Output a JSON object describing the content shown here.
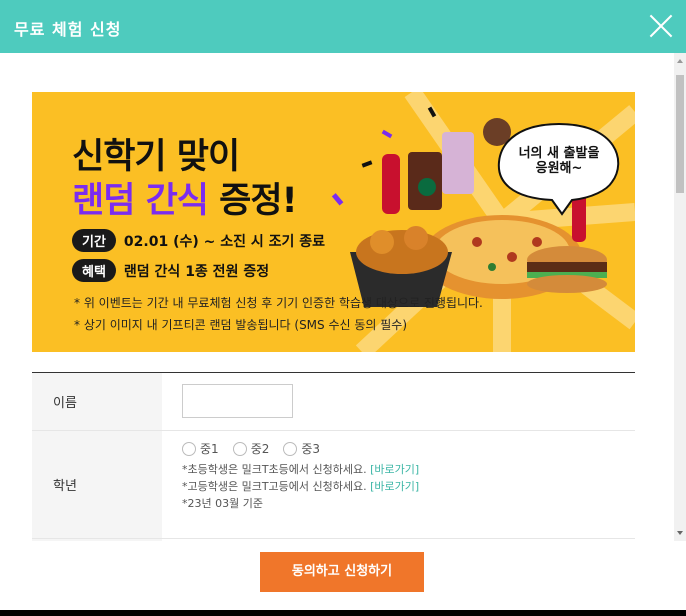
{
  "modal": {
    "title": "무료 체험 신청"
  },
  "banner": {
    "headline_line1": "신학기 맞이",
    "headline_line2_highlight": "랜덤 간식",
    "headline_line2_rest": " 증정!",
    "period_tag": "기간",
    "period_value": "02.01 (수) ~ 소진 시 조기 종료",
    "benefit_tag": "혜택",
    "benefit_value": "랜덤 간식 1종 전원 증정",
    "note1": "* 위 이벤트는 기간 내 무료체험 신청 후 기기 인증한 학습생 대상으로 진행됩니다.",
    "note2": "* 상기 이미지 내 기프티콘 랜덤 발송됩니다 (SMS 수신 동의 필수)",
    "bubble_line1": "너의 새 출발을",
    "bubble_line2": "응원해~"
  },
  "form": {
    "name_label": "이름",
    "name_value": "",
    "grade_label": "학년",
    "grade_options": [
      "중1",
      "중2",
      "중3"
    ],
    "hint_elementary": "*초등학생은 밀크T초등에서 신청하세요.",
    "hint_high": "*고등학생은 밀크T고등에서 신청하세요.",
    "shortcut_link": "[바로가기]",
    "hint_basis": "*23년 03월 기준"
  },
  "footer": {
    "apply_button": "동의하고 신청하기"
  },
  "colors": {
    "header": "#4ecbbe",
    "banner": "#fbbf24",
    "accent_purple": "#7b2cf0",
    "button": "#f0762a",
    "link": "#3cb6a6"
  }
}
